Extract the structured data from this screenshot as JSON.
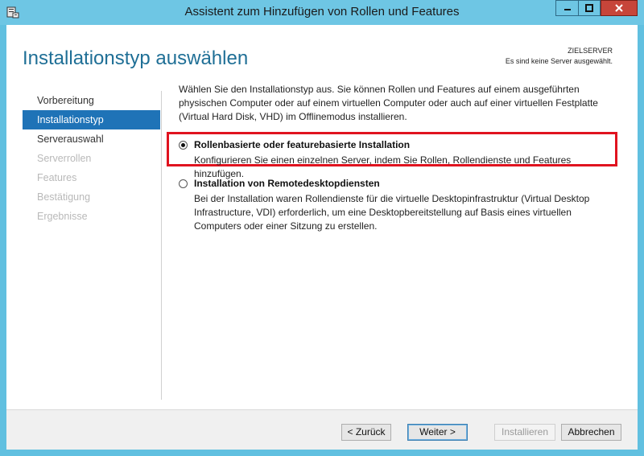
{
  "window": {
    "title": "Assistent zum Hinzufügen von Rollen und Features",
    "icon": "server-manager-icon"
  },
  "header": {
    "page_title": "Installationstyp auswählen",
    "target_label": "ZIELSERVER",
    "target_message": "Es sind keine Server ausgewählt."
  },
  "nav": {
    "items": [
      {
        "label": "Vorbereitung",
        "state": "normal"
      },
      {
        "label": "Installationstyp",
        "state": "active"
      },
      {
        "label": "Serverauswahl",
        "state": "normal"
      },
      {
        "label": "Serverrollen",
        "state": "disabled"
      },
      {
        "label": "Features",
        "state": "disabled"
      },
      {
        "label": "Bestätigung",
        "state": "disabled"
      },
      {
        "label": "Ergebnisse",
        "state": "disabled"
      }
    ]
  },
  "main": {
    "intro": "Wählen Sie den Installationstyp aus. Sie können Rollen und Features auf einem ausgeführten physischen Computer oder auf einem virtuellen Computer oder auch auf einer virtuellen Festplatte (Virtual Hard Disk, VHD) im Offlinemodus installieren.",
    "options": [
      {
        "title": "Rollenbasierte oder featurebasierte Installation",
        "description": "Konfigurieren Sie einen einzelnen Server, indem Sie Rollen, Rollendienste und Features hinzufügen.",
        "selected": true
      },
      {
        "title": "Installation von Remotedesktopdiensten",
        "description": "Bei der Installation waren Rollendienste für die virtuelle Desktopinfrastruktur (Virtual Desktop Infrastructure, VDI) erforderlich, um eine Desktopbereitstellung auf Basis eines virtuellen Computers oder einer Sitzung zu erstellen.",
        "selected": false
      }
    ]
  },
  "footer": {
    "back_label": "< Zurück",
    "next_label": "Weiter >",
    "install_label": "Installieren",
    "cancel_label": "Abbrechen"
  },
  "colors": {
    "accent": "#1f73b7",
    "title_blue": "#1f6f96",
    "highlight_red": "#e0131f",
    "frame": "#61c0e0"
  }
}
